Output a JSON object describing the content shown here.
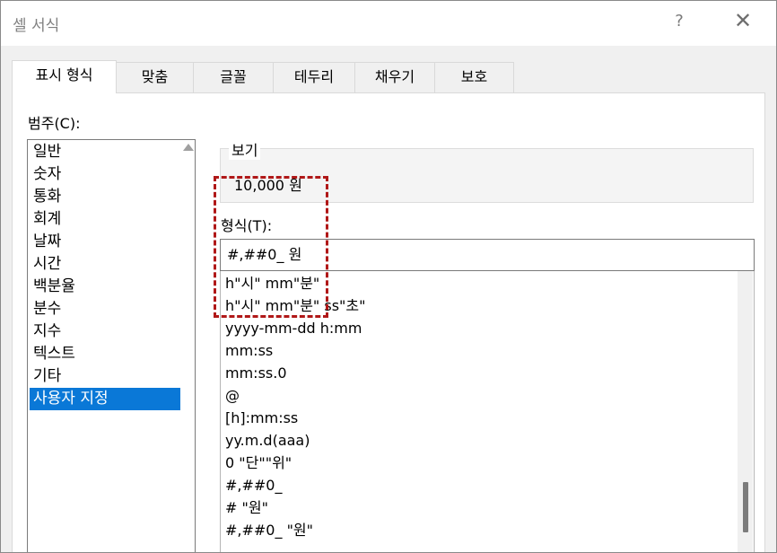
{
  "window": {
    "title": "셀 서식",
    "help_label": "?",
    "close_label": "✕"
  },
  "tabs": [
    {
      "label": "표시 형식",
      "active": true
    },
    {
      "label": "맞춤"
    },
    {
      "label": "글꼴"
    },
    {
      "label": "테두리"
    },
    {
      "label": "채우기"
    },
    {
      "label": "보호"
    }
  ],
  "category": {
    "label": "범주(C):",
    "items": [
      "일반",
      "숫자",
      "통화",
      "회계",
      "날짜",
      "시간",
      "백분율",
      "분수",
      "지수",
      "텍스트",
      "기타",
      "사용자 지정"
    ],
    "selected": "사용자 지정"
  },
  "sample": {
    "title": "보기",
    "value": "10,000 원"
  },
  "type": {
    "label": "형식(T):",
    "value": "#,##0_ 원"
  },
  "format_list": {
    "items": [
      "h\"시\" mm\"분\"",
      "h\"시\" mm\"분\" ss\"초\"",
      "yyyy-mm-dd h:mm",
      "mm:ss",
      "mm:ss.0",
      "@",
      "[h]:mm:ss",
      "yy.m.d(aaa)",
      "0 \"단\"\"위\"",
      "#,##0_",
      "# \"원\"",
      "#,##0_ \"원\""
    ],
    "scroll_fraction": 0.9
  },
  "colors": {
    "selection": "#0a78d7",
    "highlight": "#b01818",
    "dialog_bg": "#f0f0f0"
  }
}
